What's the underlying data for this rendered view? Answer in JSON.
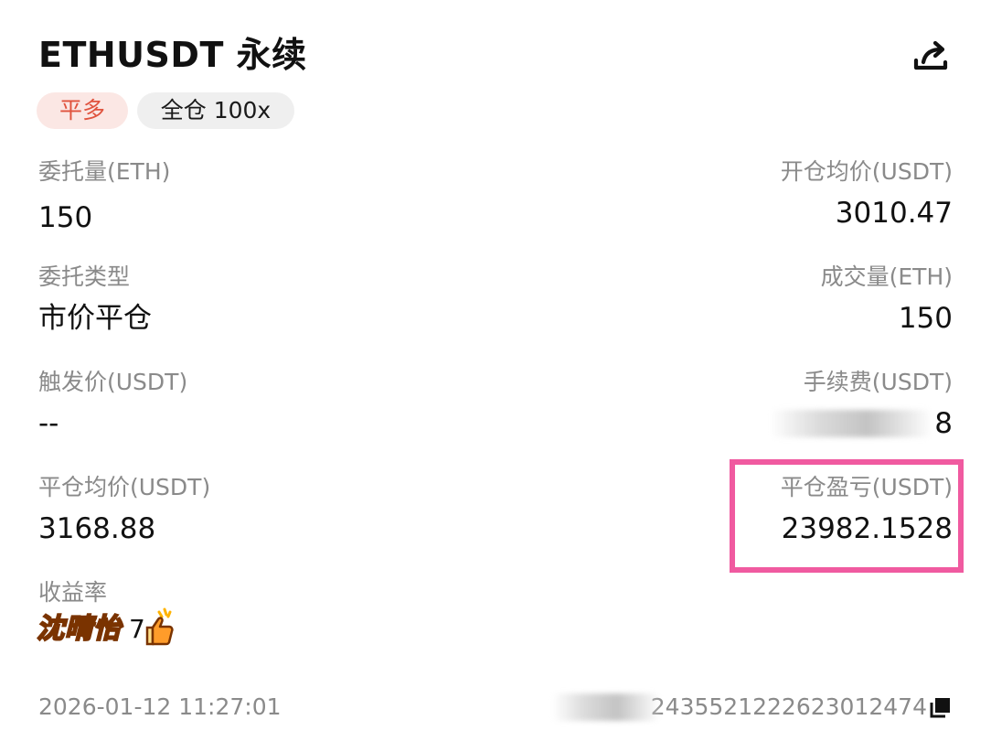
{
  "header": {
    "title": "ETHUSDT 永续",
    "share_icon": "share-icon"
  },
  "tags": {
    "side": "平多",
    "margin": "全仓 100x"
  },
  "fields": {
    "order_qty_label": "委托量(ETH)",
    "order_qty_value": "150",
    "open_avg_label": "开仓均价(USDT)",
    "open_avg_value": "3010.47",
    "order_type_label": "委托类型",
    "order_type_value": "市价平仓",
    "filled_label": "成交量(ETH)",
    "filled_value": "150",
    "trigger_label": "触发价(USDT)",
    "trigger_value": "--",
    "fee_label": "手续费(USDT)",
    "fee_value": "8",
    "close_avg_label": "平仓均价(USDT)",
    "close_avg_value": "3168.88",
    "pnl_label": "平仓盈亏(USDT)",
    "pnl_value": "23982.1528",
    "yield_label": "收益率",
    "yield_value_suffix": "7"
  },
  "sticker": {
    "text": "沈晴怡"
  },
  "footer": {
    "timestamp": "2026-01-12 11:27:01",
    "position_id": "2435521222623012474",
    "copy_icon": "copy-icon"
  },
  "colors": {
    "side_tag_bg": "#fbe7e4",
    "side_tag_text": "#e0533e",
    "highlight": "#f05aa0",
    "muted_text": "#8a8a8a"
  }
}
